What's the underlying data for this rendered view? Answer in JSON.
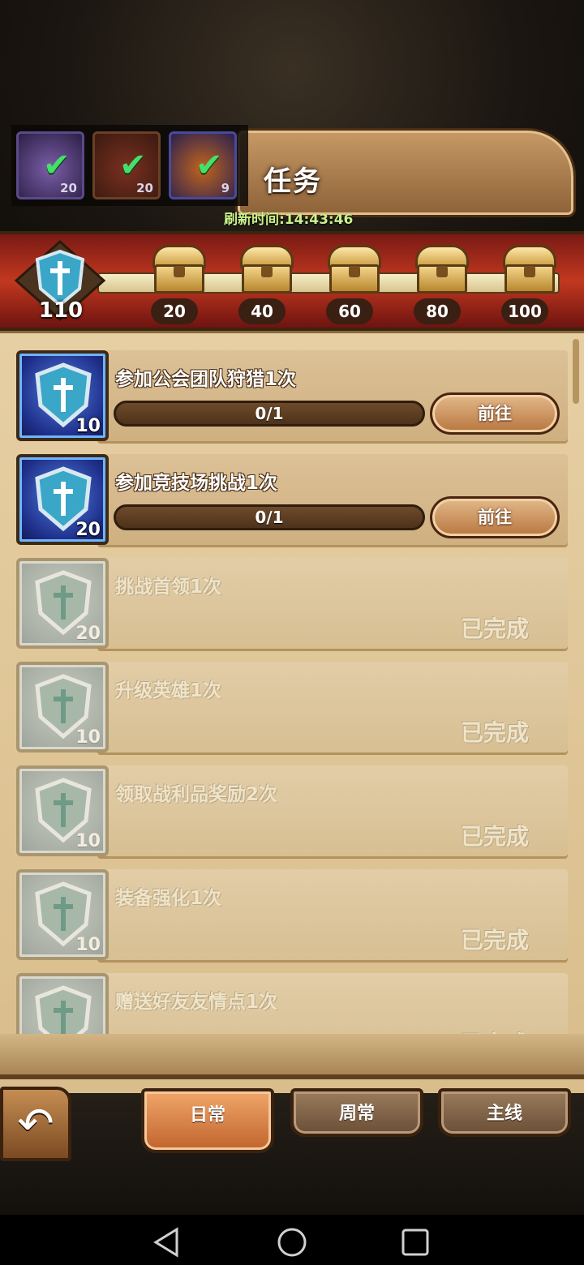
{
  "header": {
    "title": "任务",
    "refresh_time": "刷新时间:14:43:46"
  },
  "status_badges": [
    {
      "icon": "crystal-icon",
      "count": "20",
      "checked": true
    },
    {
      "icon": "shield-emblem-icon",
      "count": "20",
      "checked": true
    },
    {
      "icon": "flame-icon",
      "count": "9",
      "checked": true
    }
  ],
  "progress": {
    "current_points": "110",
    "milestones": [
      "20",
      "40",
      "60",
      "80",
      "100"
    ]
  },
  "tasks": [
    {
      "name": "参加公会团队狩猎1次",
      "points": "10",
      "progress": "0/1",
      "action": "前往",
      "status": "active"
    },
    {
      "name": "参加竞技场挑战1次",
      "points": "20",
      "progress": "0/1",
      "action": "前往",
      "status": "active"
    },
    {
      "name": "挑战首领1次",
      "points": "20",
      "status_label": "已完成",
      "status": "done"
    },
    {
      "name": "升级英雄1次",
      "points": "10",
      "status_label": "已完成",
      "status": "done"
    },
    {
      "name": "领取战利品奖励2次",
      "points": "10",
      "status_label": "已完成",
      "status": "done"
    },
    {
      "name": "装备强化1次",
      "points": "10",
      "status_label": "已完成",
      "status": "done"
    },
    {
      "name": "赠送好友友情点1次",
      "points": "",
      "status_label": "已完成",
      "status": "done"
    }
  ],
  "tabs": [
    {
      "label": "日常",
      "active": true
    },
    {
      "label": "周常",
      "active": false
    },
    {
      "label": "主线",
      "active": false
    }
  ],
  "colors": {
    "panel": "#e6cfa3",
    "band": "#c2381f",
    "check": "#44e06a",
    "refresh_text": "#c9f08a"
  }
}
